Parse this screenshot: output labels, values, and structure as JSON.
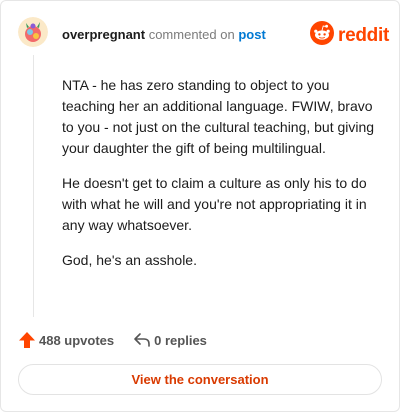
{
  "header": {
    "username": "overpregnant",
    "commented": "commented on",
    "post_link": "post"
  },
  "brand": {
    "name": "reddit",
    "color": "#ff4500"
  },
  "comment": {
    "paragraphs": [
      "NTA - he has zero standing to object to you teaching her an additional language. FWIW, bravo to you - not just on the cultural teaching, but giving your daughter the gift of being multilingual.",
      "He doesn't get to claim a culture as only his to do with what he will and you're not appropriating it in any way whatsoever.",
      "God, he's an asshole."
    ]
  },
  "actions": {
    "upvotes": "488 upvotes",
    "replies": "0 replies"
  },
  "view_button": {
    "label": "View the conversation",
    "color": "#d93a00"
  },
  "icons": {
    "avatar": "avatar",
    "logo": "reddit-snoo-icon",
    "upvote": "upvote-arrow-icon",
    "reply": "reply-arrow-icon"
  }
}
